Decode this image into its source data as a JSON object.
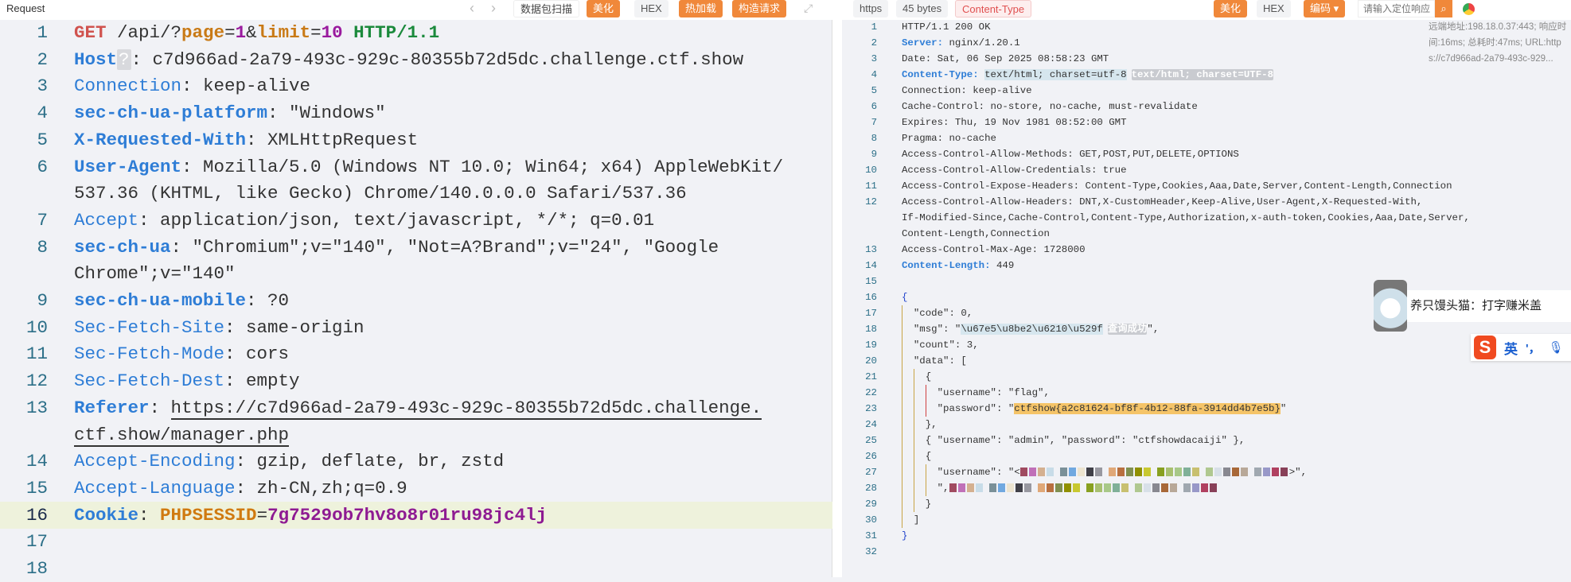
{
  "request": {
    "title": "Request",
    "nav_prev": "‹",
    "nav_next": "›",
    "buttons": {
      "scan": "数据包扫描",
      "beautify": "美化",
      "hex": "HEX",
      "hot_reload": "热加载",
      "construct": "构造请求"
    },
    "rows": [
      {
        "num": "1",
        "tokens": [
          [
            "GET",
            "m"
          ],
          [
            " ",
            "t"
          ],
          [
            "/api/?",
            "t"
          ],
          [
            "page",
            "p"
          ],
          [
            "=",
            "t"
          ],
          [
            "1",
            "n"
          ],
          [
            "&",
            "t"
          ],
          [
            "limit",
            "p"
          ],
          [
            "=",
            "t"
          ],
          [
            "10",
            "n"
          ],
          [
            " ",
            "t"
          ],
          [
            "HTTP/1.1",
            "v"
          ]
        ]
      },
      {
        "num": "2",
        "tokens": [
          [
            "Host",
            "hb"
          ],
          [
            "?",
            "q"
          ],
          [
            ": c7d966ad-2a79-493c-929c-80355b72d5dc.challenge.ctf.show",
            "t"
          ]
        ]
      },
      {
        "num": "3",
        "tokens": [
          [
            "Connection",
            "h"
          ],
          [
            ": keep-alive",
            "t"
          ]
        ]
      },
      {
        "num": "4",
        "tokens": [
          [
            "sec-ch-ua-platform",
            "hb"
          ],
          [
            ": \"Windows\"",
            "t"
          ]
        ]
      },
      {
        "num": "5",
        "tokens": [
          [
            "X-Requested-With",
            "hb"
          ],
          [
            ": XMLHttpRequest",
            "t"
          ]
        ]
      },
      {
        "num": "6",
        "tokens": [
          [
            "User-Agent",
            "hb"
          ],
          [
            ": Mozilla/5.0 (Windows NT 10.0; Win64; x64) AppleWebKit/",
            "t"
          ]
        ]
      },
      {
        "num": "",
        "tokens": [
          [
            "537.36 (KHTML, like Gecko) Chrome/140.0.0.0 Safari/537.36",
            "t"
          ]
        ]
      },
      {
        "num": "7",
        "tokens": [
          [
            "Accept",
            "h"
          ],
          [
            ": application/json, text/javascript, */*; q=0.01",
            "t"
          ]
        ]
      },
      {
        "num": "8",
        "tokens": [
          [
            "sec-ch-ua",
            "hb"
          ],
          [
            ": \"Chromium\";v=\"140\", \"Not=A?Brand\";v=\"24\", \"Google ",
            "t"
          ]
        ]
      },
      {
        "num": "",
        "tokens": [
          [
            "Chrome\";v=\"140\"",
            "t"
          ]
        ]
      },
      {
        "num": "9",
        "tokens": [
          [
            "sec-ch-ua-mobile",
            "hb"
          ],
          [
            ": ?0",
            "t"
          ]
        ]
      },
      {
        "num": "10",
        "tokens": [
          [
            "Sec-Fetch-Site",
            "h"
          ],
          [
            ": same-origin",
            "t"
          ]
        ]
      },
      {
        "num": "11",
        "tokens": [
          [
            "Sec-Fetch-Mode",
            "h"
          ],
          [
            ": cors",
            "t"
          ]
        ]
      },
      {
        "num": "12",
        "tokens": [
          [
            "Sec-Fetch-Dest",
            "h"
          ],
          [
            ": empty",
            "t"
          ]
        ]
      },
      {
        "num": "13",
        "tokens": [
          [
            "Referer",
            "hb"
          ],
          [
            ": ",
            "t"
          ],
          [
            "https://c7d966ad-2a79-493c-929c-80355b72d5dc.challenge.",
            "u"
          ]
        ]
      },
      {
        "num": "",
        "tokens": [
          [
            "ctf.show/manager.php",
            "u"
          ]
        ]
      },
      {
        "num": "14",
        "tokens": [
          [
            "Accept-Encoding",
            "h"
          ],
          [
            ": gzip, deflate, br, zstd",
            "t"
          ]
        ]
      },
      {
        "num": "15",
        "tokens": [
          [
            "Accept-Language",
            "h"
          ],
          [
            ": zh-CN,zh;q=0.9",
            "t"
          ]
        ]
      },
      {
        "num": "16",
        "highlight": true,
        "tokens": [
          [
            "Cookie",
            "hb"
          ],
          [
            ": ",
            "t"
          ],
          [
            "PHPSESSID",
            "k"
          ],
          [
            "=",
            "t"
          ],
          [
            "7g7529ob7hv8o8r01ru98jc4lj",
            "cv"
          ]
        ]
      },
      {
        "num": "17",
        "tokens": []
      },
      {
        "num": "18",
        "tokens": []
      }
    ]
  },
  "response": {
    "tags": {
      "scheme": "https",
      "size": "45 bytes",
      "content_type": "Content-Type"
    },
    "buttons": {
      "beautify": "美化",
      "hex": "HEX",
      "encoding": "编码 ▾"
    },
    "search_placeholder": "请输入定位响应",
    "info": [
      "远端地址:198.18.0.37:443; 响应时",
      "间:16ms; 总耗时:47ms; URL:http",
      "s://c7d966ad-2a79-493c-929..."
    ],
    "rows": [
      {
        "num": "1",
        "tokens": [
          [
            "HTTP/1.1 200 OK",
            "t"
          ]
        ]
      },
      {
        "num": "2",
        "tokens": [
          [
            "Server:",
            "hb"
          ],
          [
            " nginx/1.20.1",
            "t"
          ]
        ]
      },
      {
        "num": "3",
        "tokens": [
          [
            "Date: Sat, 06 Sep 2025 08:58:23 GMT",
            "t"
          ]
        ]
      },
      {
        "num": "4",
        "tokens": [
          [
            "Content-Type:",
            "hb"
          ],
          [
            " ",
            "t"
          ],
          [
            "text/html; charset=utf-8",
            "sel"
          ],
          [
            "text/html; charset=UTF-8",
            "badge"
          ]
        ]
      },
      {
        "num": "5",
        "tokens": [
          [
            "Connection: keep-alive",
            "t"
          ]
        ]
      },
      {
        "num": "6",
        "tokens": [
          [
            "Cache-Control: no-store, no-cache, must-revalidate",
            "t"
          ]
        ]
      },
      {
        "num": "7",
        "tokens": [
          [
            "Expires: Thu, 19 Nov 1981 08:52:00 GMT",
            "t"
          ]
        ]
      },
      {
        "num": "8",
        "tokens": [
          [
            "Pragma: no-cache",
            "t"
          ]
        ]
      },
      {
        "num": "9",
        "tokens": [
          [
            "Access-Control-Allow-Methods: GET,POST,PUT,DELETE,OPTIONS",
            "t"
          ]
        ]
      },
      {
        "num": "10",
        "tokens": [
          [
            "Access-Control-Allow-Credentials: true",
            "t"
          ]
        ]
      },
      {
        "num": "11",
        "tokens": [
          [
            "Access-Control-Expose-Headers: Content-Type,Cookies,Aaa,Date,Server,Content-Length,Connection",
            "t"
          ]
        ]
      },
      {
        "num": "12",
        "tokens": [
          [
            "Access-Control-Allow-Headers: DNT,X-CustomHeader,Keep-Alive,User-Agent,X-Requested-With,",
            "t"
          ]
        ]
      },
      {
        "num": "",
        "tokens": [
          [
            "If-Modified-Since,Cache-Control,Content-Type,Authorization,x-auth-token,Cookies,Aaa,Date,Server,",
            "t"
          ]
        ]
      },
      {
        "num": "",
        "tokens": [
          [
            "Content-Length,Connection",
            "t"
          ]
        ]
      },
      {
        "num": "13",
        "tokens": [
          [
            "Access-Control-Max-Age: 1728000",
            "t"
          ]
        ]
      },
      {
        "num": "14",
        "tokens": [
          [
            "Content-Length:",
            "hb"
          ],
          [
            " 449",
            "t"
          ]
        ]
      },
      {
        "num": "15",
        "tokens": []
      },
      {
        "num": "16",
        "tokens": [
          [
            "{",
            "br"
          ]
        ]
      },
      {
        "num": "17",
        "tokens": [
          [
            "  \"code\": 0,",
            "t"
          ]
        ]
      },
      {
        "num": "18",
        "tokens": [
          [
            "  \"msg\": \"",
            "t"
          ],
          [
            "\\u67e5\\u8be2\\u6210\\u529f",
            "sel"
          ],
          [
            "查询成功",
            "badge"
          ],
          [
            "\",",
            "t"
          ]
        ]
      },
      {
        "num": "19",
        "tokens": [
          [
            "  \"count\": 3,",
            "t"
          ]
        ]
      },
      {
        "num": "20",
        "tokens": [
          [
            "  \"data\": [",
            "t"
          ]
        ]
      },
      {
        "num": "21",
        "tokens": [
          [
            "    {",
            "t"
          ]
        ]
      },
      {
        "num": "22",
        "tokens": [
          [
            "      \"username\": \"flag\",",
            "t"
          ]
        ]
      },
      {
        "num": "23",
        "tokens": [
          [
            "      \"password\": \"",
            "t"
          ],
          [
            "ctfshow{a2c81624-bf8f-4b12-88fa-3914dd4b7e5b}",
            "flag"
          ],
          [
            "\"",
            "t"
          ]
        ]
      },
      {
        "num": "24",
        "tokens": [
          [
            "    },",
            "t"
          ]
        ]
      },
      {
        "num": "25",
        "tokens": [
          [
            "    { \"username\": \"admin\", \"password\": \"ctfshowdacaiji\" },",
            "t"
          ]
        ]
      },
      {
        "num": "26",
        "tokens": [
          [
            "    {",
            "t"
          ]
        ]
      },
      {
        "num": "27",
        "tokens": [
          [
            "      \"username\": \"<",
            "t"
          ],
          [
            "",
            "redact"
          ],
          [
            ">\",",
            "t"
          ]
        ]
      },
      {
        "num": "28",
        "tokens": [
          [
            "      \",",
            "t"
          ],
          [
            "",
            "redact"
          ]
        ]
      },
      {
        "num": "29",
        "tokens": [
          [
            "    }",
            "t"
          ]
        ]
      },
      {
        "num": "30",
        "tokens": [
          [
            "  ]",
            "t"
          ]
        ]
      },
      {
        "num": "31",
        "tokens": [
          [
            "}",
            "br"
          ]
        ]
      },
      {
        "num": "32",
        "tokens": []
      }
    ]
  },
  "overlay": {
    "notification": "养只馒头猫：打字赚米盖",
    "ime_logo": "S",
    "ime_mode": "英",
    "ime_punct": "'，"
  },
  "redaction_colors": [
    "#a04a60",
    "#c070b8",
    "#d4b090",
    "#c8dce8",
    "#7a9098",
    "#70a8e0",
    "#ece4d0",
    "#404048",
    "#9898a0",
    "#e0a878",
    "#b87040",
    "#809050",
    "#909000",
    "#c8c830",
    "#88a020",
    "#a8c070",
    "#a8c888",
    "#80b098",
    "#c8c070",
    "#b0c890",
    "#d8e0e8",
    "#888890",
    "#a86838",
    "#b8a898",
    "#a0a8b0",
    "#9898c8",
    "#b04060",
    "#884058"
  ],
  "colors": {
    "accent": "#f0883a",
    "flag_highlight": "#f5c468",
    "header_blue": "#2e7dd6"
  }
}
